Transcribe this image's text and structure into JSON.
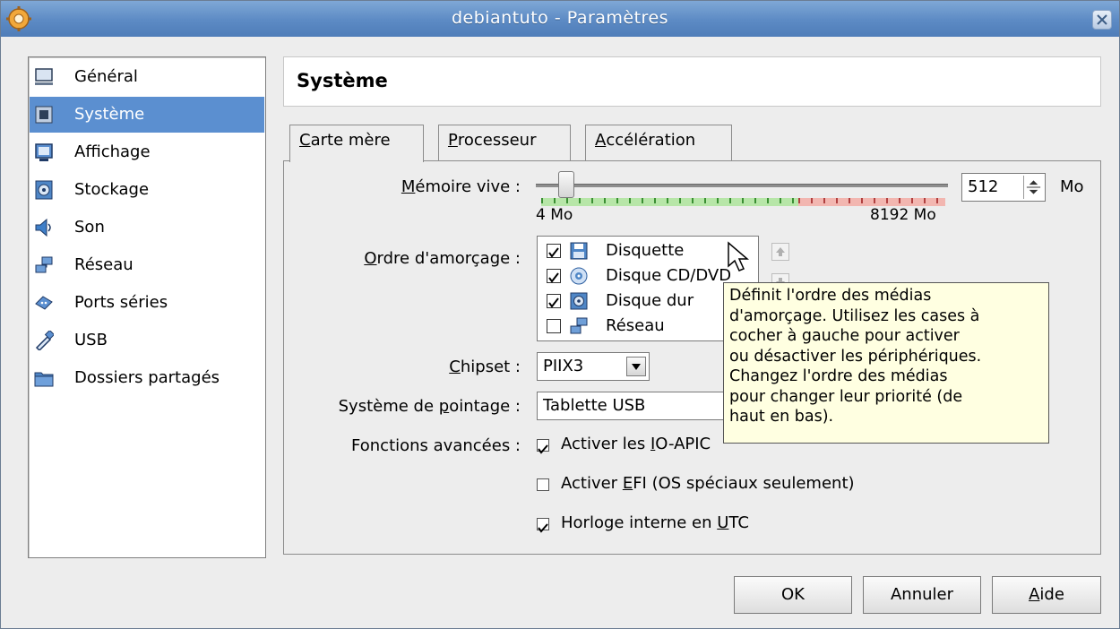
{
  "window": {
    "title": "debiantuto - Paramètres",
    "accent": "#5b8fd0",
    "tooltip_bg": "#ffffe1"
  },
  "sidebar": {
    "items": [
      {
        "label": "Général",
        "icon": "monitor-icon"
      },
      {
        "label": "Système",
        "icon": "chip-icon",
        "selected": true
      },
      {
        "label": "Affichage",
        "icon": "display-icon"
      },
      {
        "label": "Stockage",
        "icon": "disk-icon"
      },
      {
        "label": "Son",
        "icon": "speaker-icon"
      },
      {
        "label": "Réseau",
        "icon": "network-icon"
      },
      {
        "label": "Ports séries",
        "icon": "serial-port-icon"
      },
      {
        "label": "USB",
        "icon": "usb-icon"
      },
      {
        "label": "Dossiers partagés",
        "icon": "folder-icon"
      }
    ]
  },
  "main": {
    "title": "Système",
    "tabs": [
      {
        "label_u": "C",
        "label_rest": "arte mère",
        "active": true
      },
      {
        "label_u": "P",
        "label_rest": "rocesseur"
      },
      {
        "label_u": "A",
        "label_rest": "ccélération"
      }
    ]
  },
  "memory": {
    "label_u": "M",
    "label_rest": "émoire vive :",
    "value": "512",
    "unit": "Mo",
    "min_label": "4 Mo",
    "max_label": "8192 Mo",
    "fraction": 0.062
  },
  "boot": {
    "label_u": "O",
    "label_rest": "rdre d'amorçage :",
    "items": [
      {
        "label": "Disquette",
        "checked": true,
        "icon": "floppy-icon"
      },
      {
        "label": "Disque CD/DVD",
        "checked": true,
        "icon": "cd-icon"
      },
      {
        "label": "Disque dur",
        "checked": true,
        "icon": "hard-disk-icon"
      },
      {
        "label": "Réseau",
        "checked": false,
        "icon": "network-icon"
      }
    ]
  },
  "chipset": {
    "label_u": "C",
    "label_rest": "hipset :",
    "value": "PIIX3"
  },
  "pointing": {
    "label_pre": "Système de ",
    "label_u": "p",
    "label_rest": "ointage :",
    "value": "Tablette USB"
  },
  "advanced": {
    "label": "Fonctions avancées :",
    "ioapic": {
      "pre": "Activer les ",
      "u": "I",
      "rest": "O-APIC",
      "checked": true
    },
    "efi": {
      "pre": "Activer ",
      "u": "E",
      "rest": "FI (OS spéciaux seulement)",
      "checked": false
    },
    "utc": {
      "pre": "Horloge interne en ",
      "u": "U",
      "rest": "TC",
      "checked": true
    }
  },
  "tooltip": {
    "lines": [
      "Définit l'ordre des médias",
      "d'amorçage. Utilisez les cases à",
      "cocher à gauche pour activer",
      "ou désactiver les périphériques.",
      "Changez l'ordre des médias",
      "pour changer leur priorité (de",
      "haut en bas)."
    ]
  },
  "buttons": {
    "ok": "OK",
    "cancel": "Annuler",
    "help_u": "A",
    "help_rest": "ide"
  }
}
